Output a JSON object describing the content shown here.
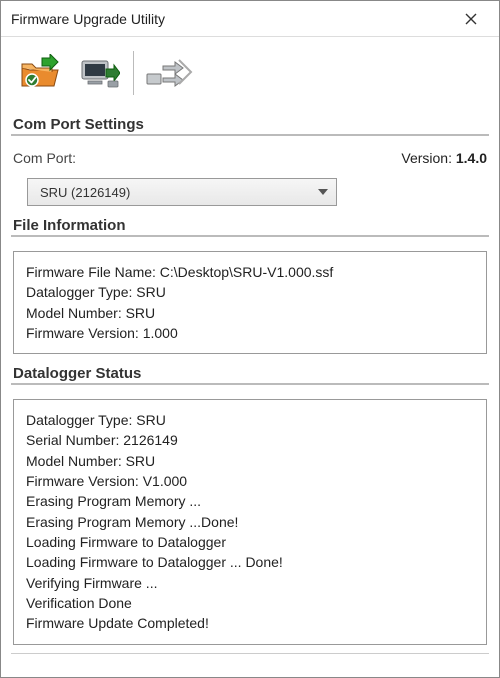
{
  "window": {
    "title": "Firmware Upgrade Utility"
  },
  "toolbar": {
    "open_icon": "open-file-icon",
    "transfer_icon": "transfer-icon",
    "read_icon": "read-icon"
  },
  "comport": {
    "heading": "Com Port Settings",
    "label": "Com Port:",
    "selected": "SRU (2126149)",
    "version_label": "Version:",
    "version_value": "1.4.0"
  },
  "fileinfo": {
    "heading": "File Information",
    "lines": [
      "Firmware File Name: C:\\Desktop\\SRU-V1.000.ssf",
      "Datalogger Type: SRU",
      "Model Number: SRU",
      "Firmware Version: 1.000"
    ]
  },
  "status": {
    "heading": "Datalogger Status",
    "lines": [
      "Datalogger Type: SRU",
      "Serial Number: 2126149",
      "Model Number: SRU",
      "Firmware Version: V1.000",
      "Erasing Program Memory ...",
      "Erasing Program Memory ...Done!",
      "Loading Firmware to Datalogger",
      "Loading Firmware to Datalogger ... Done!",
      "Verifying Firmware ...",
      "Verification Done",
      "Firmware Update Completed!"
    ]
  }
}
